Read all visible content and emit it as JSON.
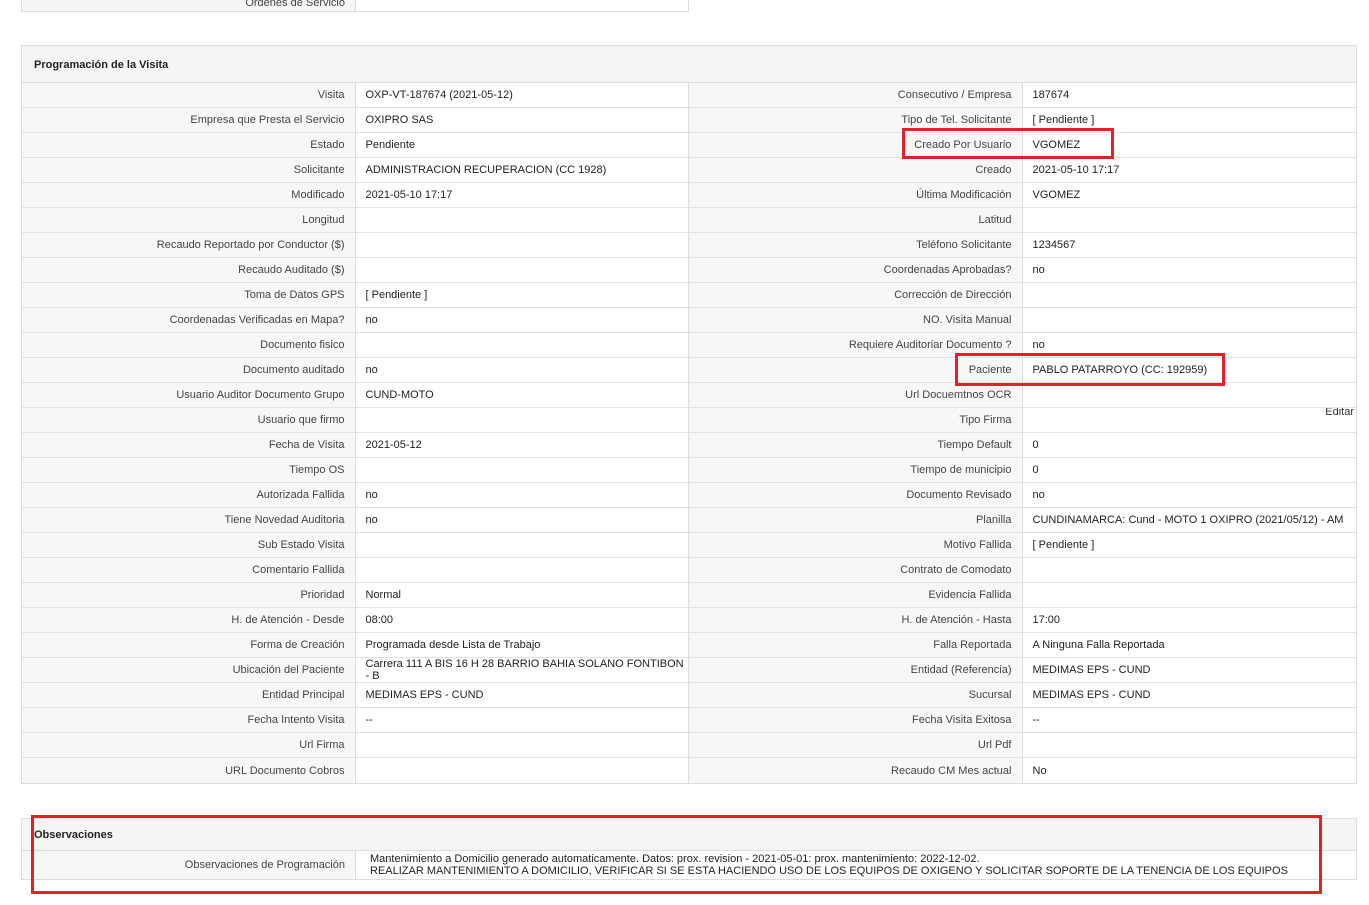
{
  "top_fragment": {
    "label": "Órdenes de Servicio"
  },
  "panel": {
    "title": "Programación de la Visita",
    "action_label": "Editar",
    "rows": [
      {
        "l1": "Visita",
        "v1": "OXP-VT-187674 (2021-05-12)",
        "l2": "Consecutivo / Empresa",
        "v2": "187674"
      },
      {
        "l1": "Empresa que Presta el Servicio",
        "v1": "OXIPRO SAS",
        "l2": "Tipo de Tel. Solicitante",
        "v2": "[ Pendiente ]"
      },
      {
        "l1": "Estado",
        "v1": "Pendiente",
        "l2": "Creado Por Usuario",
        "v2": "VGOMEZ"
      },
      {
        "l1": "Solicitante",
        "v1": "ADMINISTRACION RECUPERACION (CC 1928)",
        "l2": "Creado",
        "v2": "2021-05-10 17:17"
      },
      {
        "l1": "Modificado",
        "v1": "2021-05-10 17:17",
        "l2": "Última Modificación",
        "v2": " VGOMEZ"
      },
      {
        "l1": "Longitud",
        "v1": "",
        "l2": "Latitud",
        "v2": ""
      },
      {
        "l1": "Recaudo Reportado por Conductor ($)",
        "v1": "",
        "l2": "Teléfono Solicitante",
        "v2": "1234567"
      },
      {
        "l1": "Recaudo Auditado ($)",
        "v1": "",
        "l2": "Coordenadas Aprobadas?",
        "v2": " no"
      },
      {
        "l1": "Toma de Datos GPS",
        "v1": "[ Pendiente ]",
        "l2": "Corrección de Dirección",
        "v2": ""
      },
      {
        "l1": "Coordenadas Verificadas en Mapa?",
        "v1": " no",
        "l2": "NO. Visita Manual",
        "v2": ""
      },
      {
        "l1": "Documento fisico",
        "v1": "",
        "l2": "Requiere Auditoriar Documento ?",
        "v2": " no"
      },
      {
        "l1": "Documento auditado",
        "v1": " no",
        "l2": "Paciente",
        "v2": "PABLO PATARROYO (CC: 192959)"
      },
      {
        "l1": "Usuario Auditor Documento Grupo",
        "v1": "CUND-MOTO",
        "l2": "Url Docuemtnos OCR",
        "v2": ""
      },
      {
        "l1": "Usuario que firmo",
        "v1": "",
        "l2": "Tipo Firma",
        "v2": ""
      },
      {
        "l1": "Fecha de Visita",
        "v1": " 2021-05-12",
        "l2": "Tiempo Default",
        "v2": "0"
      },
      {
        "l1": "Tiempo OS",
        "v1": "",
        "l2": "Tiempo de municipio",
        "v2": "0"
      },
      {
        "l1": "Autorizada Fallida",
        "v1": " no",
        "l2": "Documento Revisado",
        "v2": " no"
      },
      {
        "l1": "Tiene Novedad Auditoria",
        "v1": " no",
        "l2": "Planilla",
        "v2": "CUNDINAMARCA: Cund - MOTO 1 OXIPRO (2021/05/12) - AM"
      },
      {
        "l1": "Sub Estado Visita",
        "v1": "",
        "l2": "Motivo Fallida",
        "v2": "[ Pendiente ]"
      },
      {
        "l1": "Comentario Fallida",
        "v1": "",
        "l2": "Contrato de Comodato",
        "v2": ""
      },
      {
        "l1": "Prioridad",
        "v1": "Normal",
        "l2": "Evidencia Fallida",
        "v2": ""
      },
      {
        "l1": "H. de Atención - Desde",
        "v1": "08:00",
        "l2": "H. de Atención - Hasta",
        "v2": "17:00"
      },
      {
        "l1": "Forma de Creación",
        "v1": "Programada desde Lista de Trabajo",
        "l2": "Falla Reportada",
        "v2": "A Ninguna Falla Reportada"
      },
      {
        "l1": "Ubicación del Paciente",
        "v1": "Carrera 111 A BIS 16 H 28 BARRIO BAHIA SOLANO FONTIBON - B",
        "l2": "Entidad (Referencia)",
        "v2": "MEDIMAS EPS - CUND"
      },
      {
        "l1": "Entidad Principal",
        "v1": "MEDIMAS EPS - CUND",
        "l2": "Sucursal",
        "v2": "MEDIMAS EPS - CUND"
      },
      {
        "l1": "Fecha Intento Visita",
        "v1": "--",
        "l2": "Fecha Visita Exitosa",
        "v2": "--"
      },
      {
        "l1": "Url Firma",
        "v1": "",
        "l2": "Url Pdf",
        "v2": ""
      },
      {
        "l1": "URL Documento Cobros",
        "v1": "",
        "l2": "Recaudo CM Mes actual",
        "v2": "No"
      }
    ]
  },
  "observaciones": {
    "title": "Observaciones",
    "label": "Observaciones de Programación",
    "line1": "Mantenimiento a Domicilio generado automaticamente. Datos: prox. revision - 2021-05-01: prox. mantenimiento: 2022-12-02.",
    "line2": "REALIZAR MANTENIMIENTO A DOMICILIO, VERIFICAR SI SE ESTA HACIENDO USO DE LOS EQUIPOS DE OXIGENO Y SOLICITAR SOPORTE DE LA TENENCIA DE LOS EQUIPOS"
  },
  "colors": {
    "highlight": "#e4212b",
    "label_bg": "#f7f7f7",
    "border": "#dddddd"
  }
}
